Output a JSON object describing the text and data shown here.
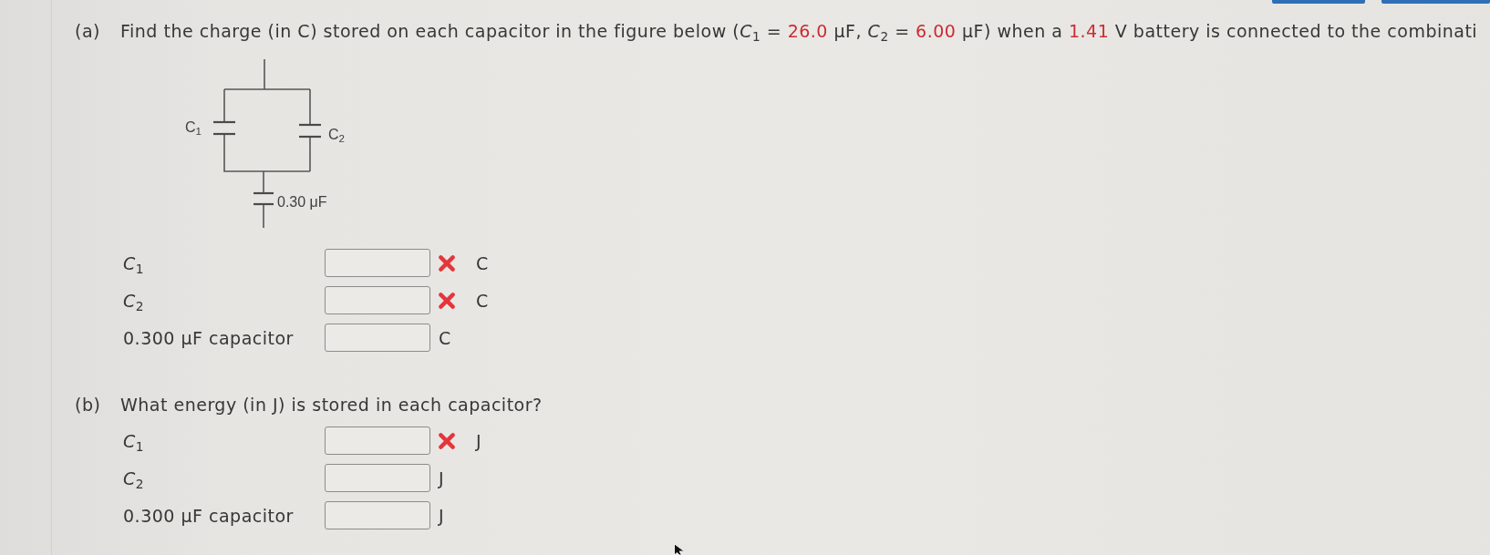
{
  "part_a": {
    "label": "(a)",
    "question": [
      {
        "kind": "text",
        "text": "Find the charge (in C) stored on each capacitor in the figure below (*C*$_{1}$ = "
      },
      {
        "kind": "given",
        "text": "26.0"
      },
      {
        "kind": "text",
        "text": " μF, *C*$_{2}$ = "
      },
      {
        "kind": "given",
        "text": "6.00"
      },
      {
        "kind": "text",
        "text": " μF) when a "
      },
      {
        "kind": "given",
        "text": "1.41"
      },
      {
        "kind": "text",
        "text": " V battery is connected to the combinati"
      }
    ],
    "figure": {
      "capacitors": [
        {
          "label": "C$_{1}$"
        },
        {
          "label": "C$_{2}$"
        },
        {
          "label": "0.30 μF"
        }
      ]
    },
    "answers": [
      {
        "label": "*C*$_{1}$",
        "incorrect": true,
        "unit": "C"
      },
      {
        "label": "*C*$_{2}$",
        "incorrect": true,
        "unit": "C"
      },
      {
        "label": "0.300 μF capacitor",
        "incorrect": false,
        "unit": "C"
      }
    ]
  },
  "part_b": {
    "label": "(b)",
    "question": [
      {
        "kind": "text",
        "text": "What energy (in J) is stored in each capacitor?"
      }
    ],
    "answers": [
      {
        "label": "*C*$_{1}$",
        "incorrect": true,
        "unit": "J"
      },
      {
        "label": "*C*$_{2}$",
        "incorrect": false,
        "unit": "J"
      },
      {
        "label": "0.300 μF capacitor",
        "incorrect": false,
        "unit": "J"
      }
    ]
  }
}
